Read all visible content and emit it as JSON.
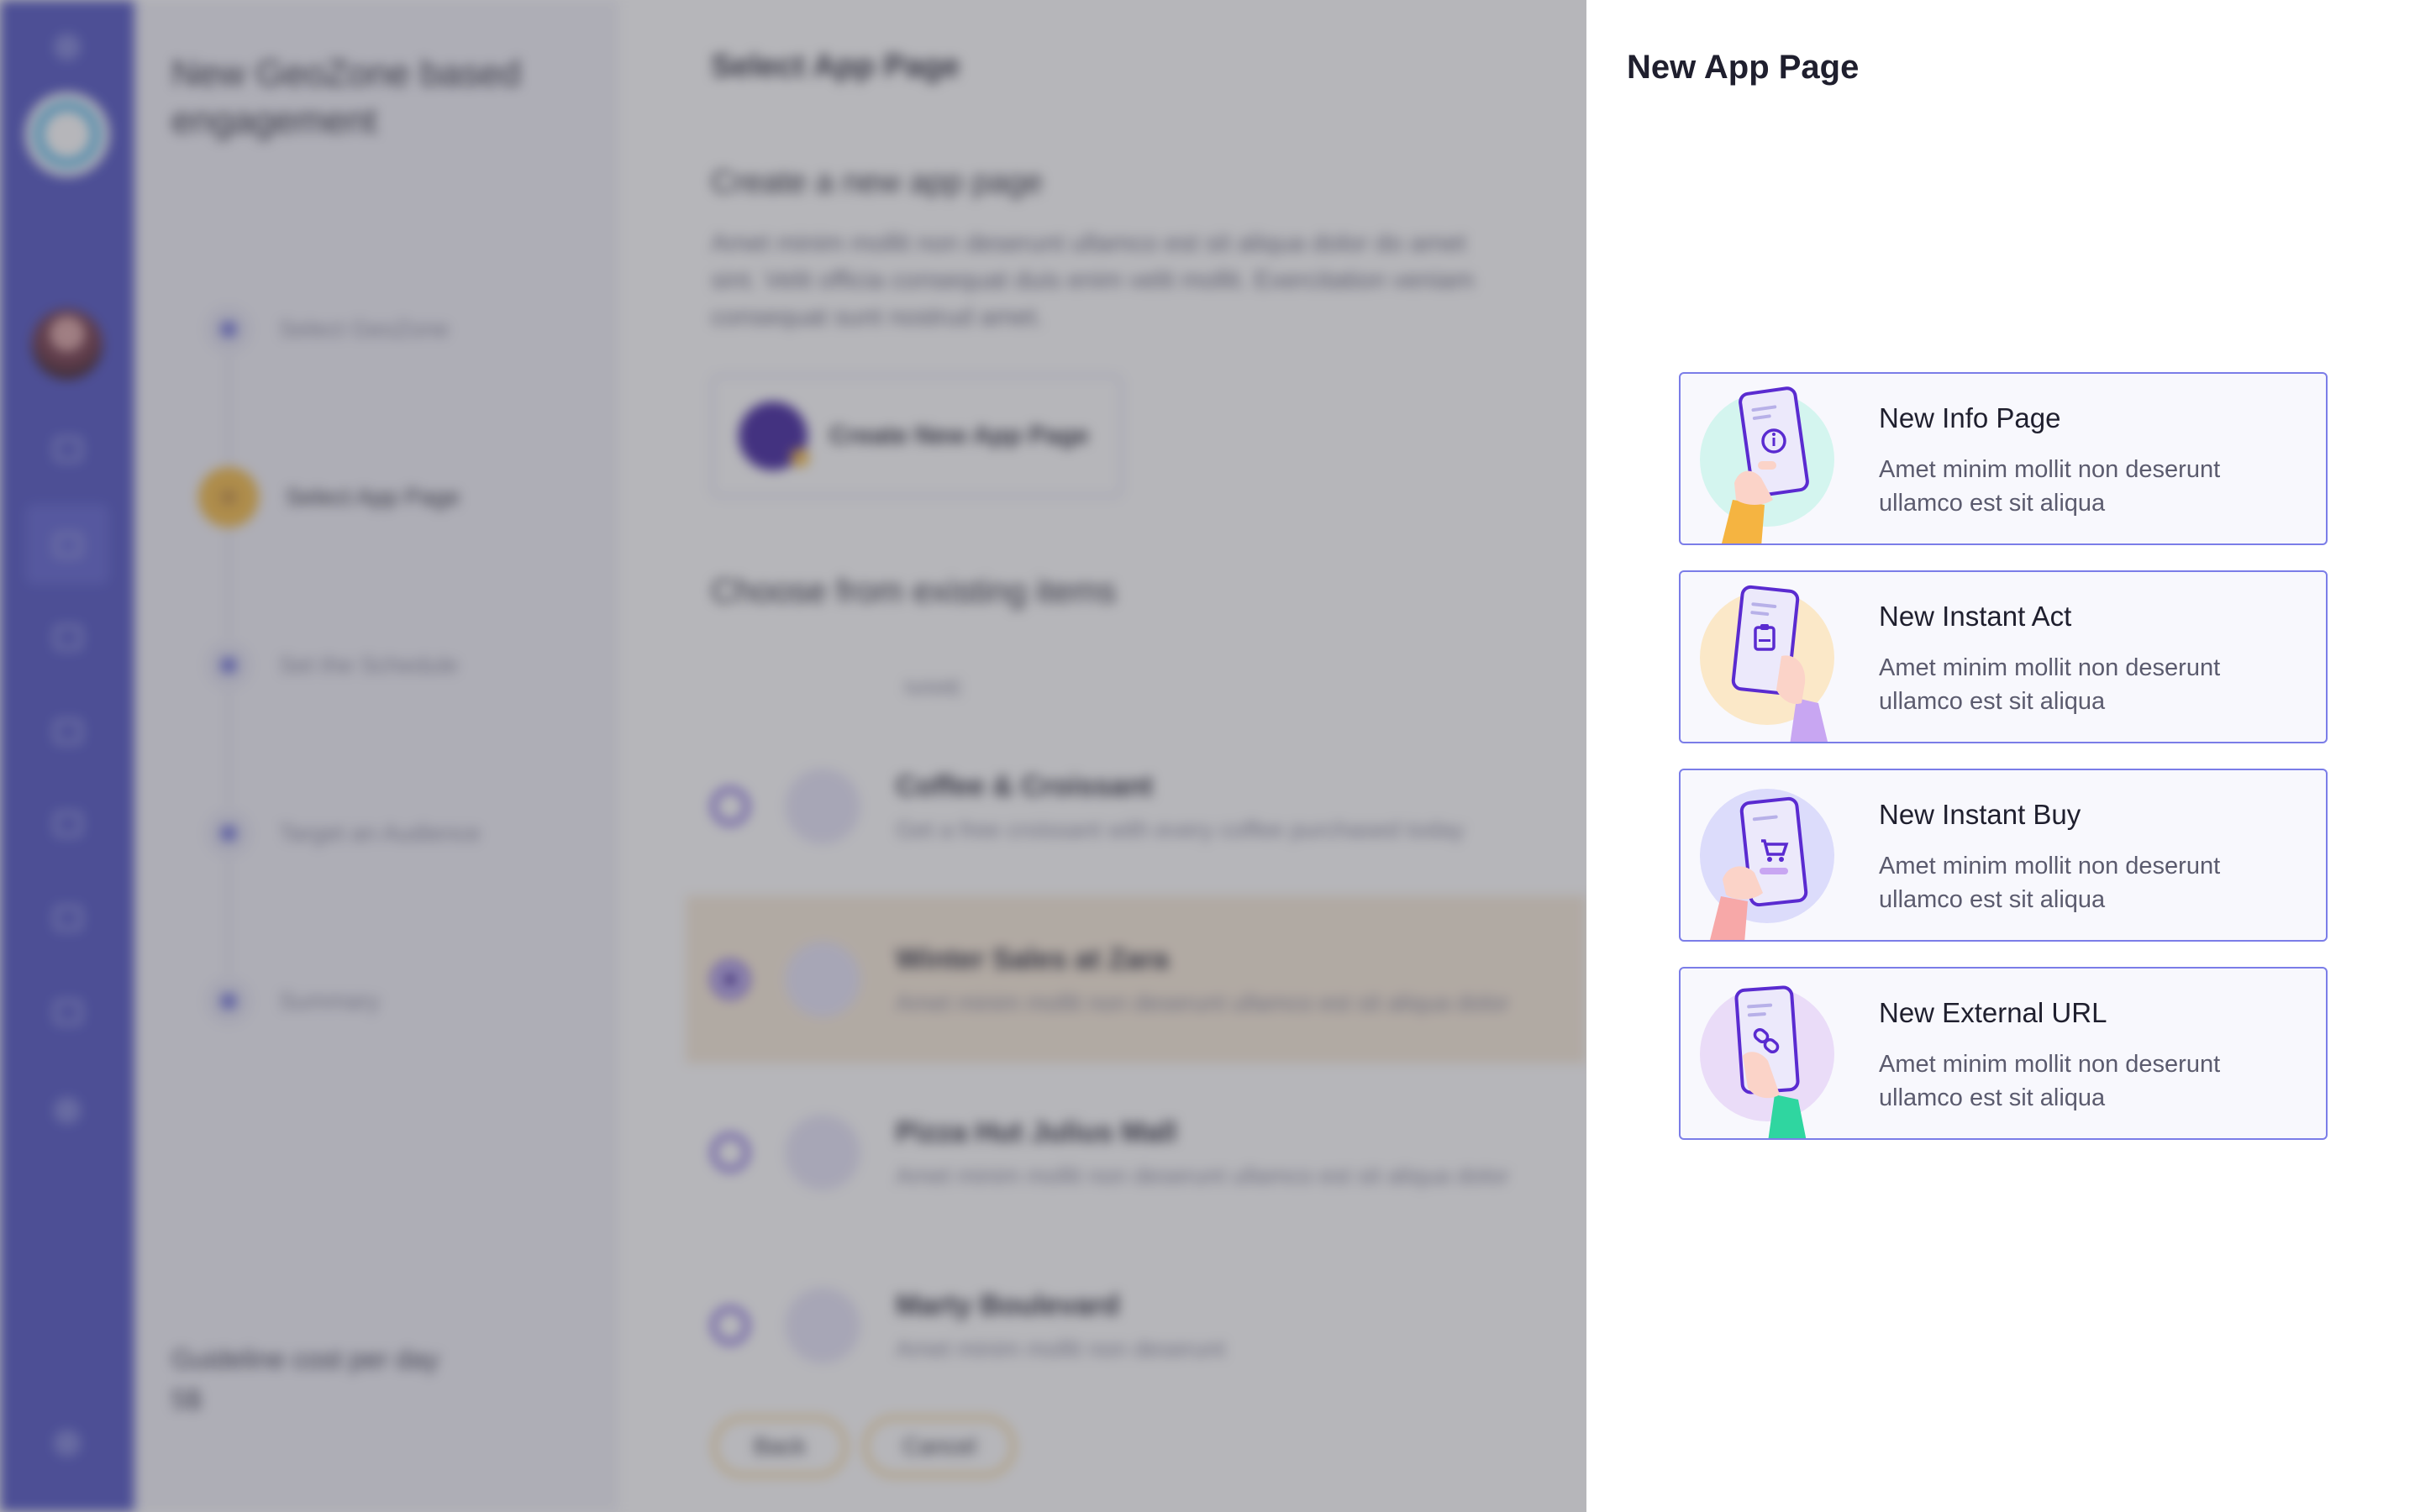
{
  "background": {
    "steps_title": "New GeoZone based engagement",
    "steps": [
      {
        "label": "Select GeoZone"
      },
      {
        "label": "Select App Page"
      },
      {
        "label": "Set the Schedule"
      },
      {
        "label": "Target an Audience"
      },
      {
        "label": "Summary"
      }
    ],
    "cost_label": "Guideline cost per day",
    "cost_value": "5$",
    "content_title": "Select App Page",
    "create_heading": "Create a new app page",
    "create_paragraph": "Amet minim mollit non deserunt ullamco est sit aliqua dolor do amet sint. Velit officia consequat duis enim velit mollit. Exercitation veniam consequat sunt nostrud amet.",
    "create_button": "Create New App Page",
    "choose_heading": "Choose from existing items",
    "column_label": "NAME",
    "items": [
      {
        "name": "Coffee & Croissant",
        "desc": "Get a free croissant with every coffee purchased today"
      },
      {
        "name": "Winter Sales at Zara",
        "desc": "Amet minim mollit non deserunt ullamco est sit aliqua dolor"
      },
      {
        "name": "Pizza Hut Julius Mall",
        "desc": "Amet minim mollit non deserunt ullamco est sit aliqua dolor"
      },
      {
        "name": "Marty Boulevard",
        "desc": "Amet minim mollit non deserunt"
      }
    ],
    "back_button": "Back",
    "cancel_button": "Cancel"
  },
  "panel": {
    "title": "New App Page",
    "options": [
      {
        "title": "New Info Page",
        "desc": "Amet minim mollit non deserunt ullamco est sit aliqua",
        "icon": "info-icon",
        "bg": "#d4f5ef"
      },
      {
        "title": "New Instant Act",
        "desc": "Amet minim mollit non deserunt ullamco est sit aliqua",
        "icon": "clipboard-icon",
        "bg": "#fbe8c8"
      },
      {
        "title": "New Instant Buy",
        "desc": "Amet minim mollit non deserunt ullamco est sit aliqua",
        "icon": "cart-icon",
        "bg": "#dcdcfb"
      },
      {
        "title": "New External URL",
        "desc": "Amet minim mollit non deserunt ullamco est sit aliqua",
        "icon": "link-icon",
        "bg": "#eadcf8"
      }
    ]
  },
  "colors": {
    "accent": "#4a4ec0",
    "card_border": "#7b7de8",
    "phone_accent": "#5a2bd0"
  }
}
